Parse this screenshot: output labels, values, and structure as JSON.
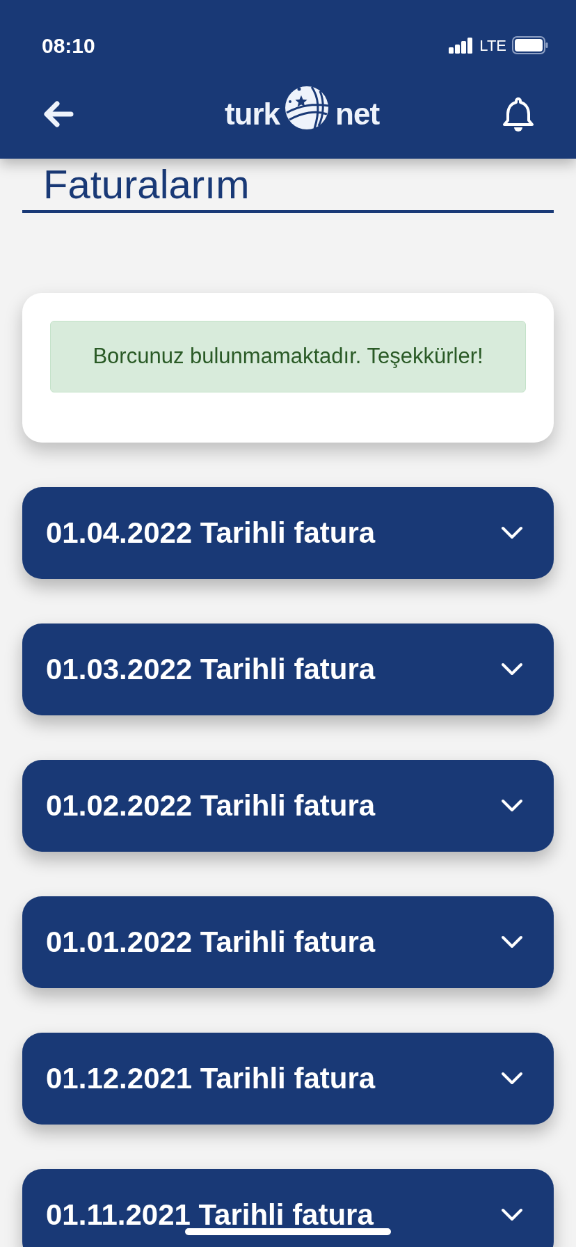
{
  "status_bar": {
    "time": "08:10",
    "network": "LTE"
  },
  "header": {
    "logo_left": "turk",
    "logo_right": "net"
  },
  "page_title": "Faturalarım",
  "notice": {
    "message": "Borcunuz bulunmamaktadır. Teşekkürler!"
  },
  "invoices": [
    {
      "label": "01.04.2022 Tarihli fatura",
      "expanded": false
    },
    {
      "label": "01.03.2022 Tarihli fatura",
      "expanded": false
    },
    {
      "label": "01.02.2022 Tarihli fatura",
      "expanded": false
    },
    {
      "label": "01.01.2022 Tarihli fatura",
      "expanded": false
    },
    {
      "label": "01.12.2021 Tarihli fatura",
      "expanded": false
    },
    {
      "label": "01.11.2021 Tarihli fatura",
      "expanded": false
    }
  ]
}
